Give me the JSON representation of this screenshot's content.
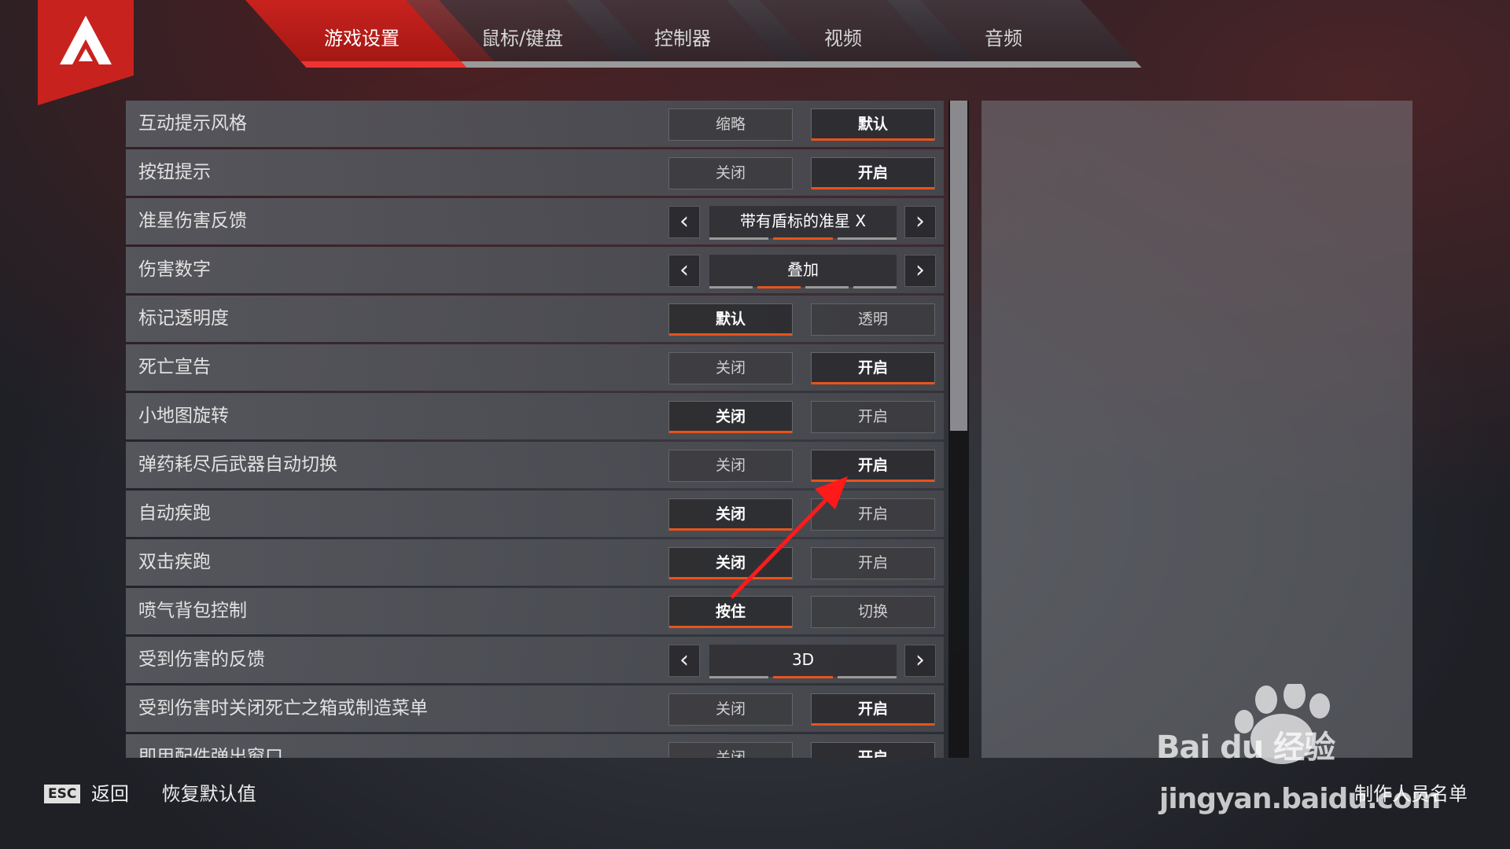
{
  "tabs": [
    {
      "label": "游戏设置",
      "active": true
    },
    {
      "label": "鼠标/键盘",
      "active": false
    },
    {
      "label": "控制器",
      "active": false
    },
    {
      "label": "视频",
      "active": false
    },
    {
      "label": "音频",
      "active": false
    }
  ],
  "settings": [
    {
      "label": "互动提示风格",
      "type": "toggle",
      "options": [
        "缩略",
        "默认"
      ],
      "selected": 1
    },
    {
      "label": "按钮提示",
      "type": "toggle",
      "options": [
        "关闭",
        "开启"
      ],
      "selected": 1
    },
    {
      "label": "准星伤害反馈",
      "type": "cycle",
      "value": "带有盾标的准星 X",
      "ticks": 3,
      "active_tick": 1
    },
    {
      "label": "伤害数字",
      "type": "cycle",
      "value": "叠加",
      "ticks": 4,
      "active_tick": 1
    },
    {
      "label": "标记透明度",
      "type": "toggle",
      "options": [
        "默认",
        "透明"
      ],
      "selected": 0
    },
    {
      "label": "死亡宣告",
      "type": "toggle",
      "options": [
        "关闭",
        "开启"
      ],
      "selected": 1
    },
    {
      "label": "小地图旋转",
      "type": "toggle",
      "options": [
        "关闭",
        "开启"
      ],
      "selected": 0
    },
    {
      "label": "弹药耗尽后武器自动切换",
      "type": "toggle",
      "options": [
        "关闭",
        "开启"
      ],
      "selected": 1
    },
    {
      "label": "自动疾跑",
      "type": "toggle",
      "options": [
        "关闭",
        "开启"
      ],
      "selected": 0
    },
    {
      "label": "双击疾跑",
      "type": "toggle",
      "options": [
        "关闭",
        "开启"
      ],
      "selected": 0
    },
    {
      "label": "喷气背包控制",
      "type": "toggle",
      "options": [
        "按住",
        "切换"
      ],
      "selected": 0
    },
    {
      "label": "受到伤害的反馈",
      "type": "cycle",
      "value": "3D",
      "ticks": 3,
      "active_tick": 1
    },
    {
      "label": "受到伤害时关闭死亡之箱或制造菜单",
      "type": "toggle",
      "options": [
        "关闭",
        "开启"
      ],
      "selected": 1
    },
    {
      "label": "即用配件弹出窗口",
      "type": "toggle",
      "options": [
        "关闭",
        "开启"
      ],
      "selected": 1
    }
  ],
  "footer": {
    "esc_key": "ESC",
    "back_label": "返回",
    "reset_label": "恢复默认值",
    "credits_label": "制作人员名单"
  },
  "watermark": {
    "brand": "Bai du 经验",
    "url": "jingyan.baidu.com"
  },
  "colors": {
    "accent": "#e8531b",
    "tab_active": "#c8221e",
    "logo": "#c8221e"
  }
}
